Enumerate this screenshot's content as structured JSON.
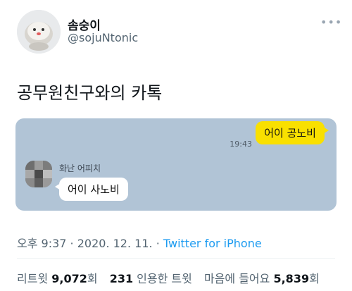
{
  "profile": {
    "display_name": "솜숭이",
    "handle": "@sojuNtonic"
  },
  "tweet": {
    "text": "공무원친구와의 카톡"
  },
  "chat": {
    "my_message": "어이 공노비",
    "my_time": "19:43",
    "friend_name": "화난 어피치",
    "friend_message": "어이 사노비"
  },
  "meta": {
    "time": "오후 9:37",
    "sep1": " · ",
    "date": "2020. 12. 11.",
    "sep2": " · ",
    "source": "Twitter for iPhone"
  },
  "stats": {
    "retweets_label": "리트윗 ",
    "retweets_count": "9,072",
    "retweets_unit": "회",
    "quotes_count": "231",
    "quotes_label": " 인용한 트윗",
    "likes_label": "마음에 들어요 ",
    "likes_count": "5,839",
    "likes_unit": "회"
  },
  "icons": {
    "more": "more-options-icon"
  },
  "colors": {
    "chat_background": "#b1c4d6",
    "my_bubble": "#f9e000",
    "link": "#1d9bf0"
  }
}
